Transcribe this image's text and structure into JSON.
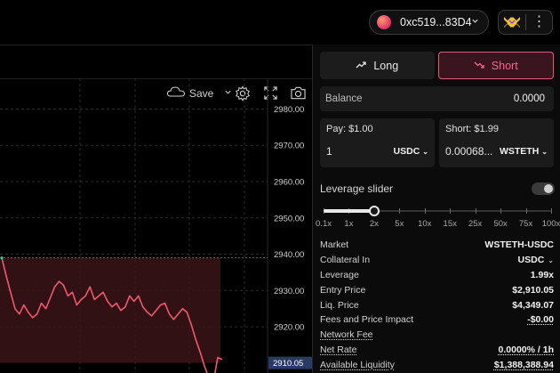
{
  "header": {
    "wallet_address": "0xc519...83D4",
    "wallet_icon": "wallet-avatar-icon",
    "logo_icon": "gmx-logo-icon",
    "menu_icon": "kebab-icon"
  },
  "chart_toolbar": {
    "save_label": "Save",
    "icons": [
      "cloud-icon",
      "chevron-down-icon",
      "gear-icon",
      "fullscreen-icon",
      "camera-icon"
    ]
  },
  "chart_data": {
    "type": "line",
    "y_tick_labels": [
      "2980.00",
      "2970.00",
      "2960.00",
      "2950.00",
      "2940.00",
      "2930.00",
      "2920.00"
    ],
    "ylim": [
      2908,
      2986
    ],
    "current_price_label": "2910.05",
    "reference_price": 2939.0,
    "reference_band": [
      2910.05,
      2939.0
    ],
    "grid": true,
    "series": [
      {
        "color": "#f0586e",
        "x": [
          0,
          1,
          2,
          3,
          4,
          5,
          6,
          7,
          8,
          9,
          10,
          11,
          12,
          13,
          14,
          15,
          16,
          17,
          18,
          19,
          20,
          21,
          22,
          23,
          24,
          25,
          26,
          27,
          28,
          29,
          30,
          31,
          32,
          33,
          34,
          35,
          36,
          37,
          38,
          39,
          40,
          41,
          42,
          43,
          44,
          45,
          46,
          47,
          48,
          49,
          50
        ],
        "values": [
          2939.0,
          2934.0,
          2929.5,
          2925.0,
          2923.5,
          2926.0,
          2924.0,
          2922.5,
          2923.5,
          2926.5,
          2925.0,
          2928.0,
          2931.0,
          2932.5,
          2931.5,
          2928.5,
          2929.5,
          2926.0,
          2927.5,
          2928.5,
          2931.0,
          2927.5,
          2928.5,
          2929.5,
          2927.0,
          2925.5,
          2926.5,
          2924.5,
          2925.5,
          2928.5,
          2927.0,
          2928.5,
          2925.5,
          2924.0,
          2923.0,
          2924.5,
          2926.0,
          2926.5,
          2923.5,
          2922.0,
          2923.5,
          2925.0,
          2924.0,
          2920.5,
          2916.5,
          2913.0,
          2909.0,
          2906.0,
          2905.0,
          2911.5,
          2911.0
        ]
      }
    ]
  },
  "panel": {
    "tabs": [
      {
        "label": "Long",
        "icon": "trend-up-icon"
      },
      {
        "label": "Short",
        "icon": "trend-down-icon"
      }
    ],
    "balance_label": "Balance",
    "balance_value": "0.0000",
    "pay_label": "Pay: $1.00",
    "pay_amount": "1",
    "pay_token": "USDC",
    "short_label": "Short: $1.99",
    "short_amount": "0.00068...",
    "short_token": "WSTETH",
    "leverage_label": "Leverage slider",
    "leverage_marks": [
      "0.1x",
      "1x",
      "2x",
      "5x",
      "10x",
      "15x",
      "25x",
      "50x",
      "75x",
      "100x"
    ],
    "leverage_selected_index": 2,
    "leverage_toggle_on": true,
    "info": [
      {
        "label": "Market",
        "value": "WSTETH-USDC"
      },
      {
        "label": "Collateral In",
        "value": "USDC"
      },
      {
        "label": "Leverage",
        "value": "1.99x"
      },
      {
        "label": "Entry Price",
        "value": "$2,910.05"
      },
      {
        "label": "Liq. Price",
        "value": "$4,349.07"
      },
      {
        "label": "Fees and Price Impact",
        "value": "-$0.00"
      },
      {
        "label": "Network Fee",
        "value": ""
      },
      {
        "label": "Net Rate",
        "value": "0.0000% / 1h"
      },
      {
        "label": "Available Liquidity",
        "value": "$1,388,388.94"
      }
    ]
  },
  "colors": {
    "short_accent": "#e05a78",
    "line": "#f0586e",
    "panel_bg": "#0b0b0b"
  }
}
